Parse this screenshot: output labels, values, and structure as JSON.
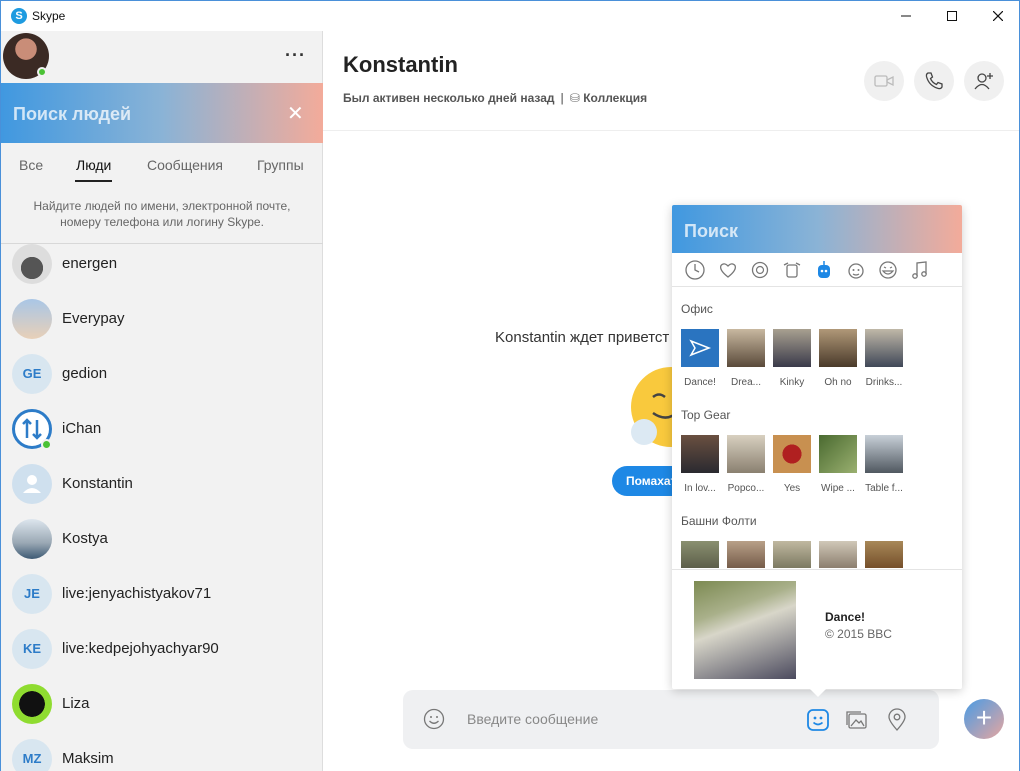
{
  "window": {
    "title": "Skype"
  },
  "sidebar": {
    "search_placeholder": "Поиск людей",
    "tabs": [
      {
        "label": "Все",
        "active": false
      },
      {
        "label": "Люди",
        "active": true
      },
      {
        "label": "Сообщения",
        "active": false
      },
      {
        "label": "Группы",
        "active": false
      }
    ],
    "hint": "Найдите людей по имени, электронной почте, номеру телефона или логину Skype.",
    "contacts": [
      {
        "name": "energen",
        "initials": "",
        "avatar": "photo",
        "online": false
      },
      {
        "name": "Everypay",
        "initials": "",
        "avatar": "photo",
        "online": false
      },
      {
        "name": "gedion",
        "initials": "GE",
        "avatar": "initials",
        "online": false
      },
      {
        "name": "iChan",
        "initials": "",
        "avatar": "photo",
        "online": true
      },
      {
        "name": "Konstantin",
        "initials": "",
        "avatar": "default-user",
        "online": false
      },
      {
        "name": "Kostya",
        "initials": "",
        "avatar": "photo",
        "online": false
      },
      {
        "name": "live:jenyachistyakov71",
        "initials": "JE",
        "avatar": "initials",
        "online": false
      },
      {
        "name": "live:kedpejohyachyar90",
        "initials": "KE",
        "avatar": "initials",
        "online": false
      },
      {
        "name": "Liza",
        "initials": "",
        "avatar": "photo",
        "online": false
      },
      {
        "name": "Maksim",
        "initials": "MZ",
        "avatar": "initials",
        "online": false
      }
    ]
  },
  "chat": {
    "title": "Konstantin",
    "last_seen": "Был активен несколько дней назад",
    "collection_label": "Коллекция",
    "awaiting_text": "Konstantin ждет приветст",
    "wave_button": "Помахат",
    "composer_placeholder": "Введите сообщение"
  },
  "sticker_popup": {
    "search_placeholder": "Поиск",
    "categories": [
      "clock-icon",
      "heart-icon",
      "face-icon",
      "pet-icon",
      "bot-icon",
      "monkey-icon",
      "laugh-icon",
      "music-icon"
    ],
    "active_category": "bot-icon",
    "sections": [
      {
        "title": "Офис",
        "stickers": [
          "Dance!",
          "Drea...",
          "Kinky",
          "Oh no",
          "Drinks..."
        ]
      },
      {
        "title": "Top Gear",
        "stickers": [
          "In lov...",
          "Popco...",
          "Yes",
          "Wipe ...",
          "Table f..."
        ]
      },
      {
        "title": "Башни Фолти",
        "stickers": [
          "",
          "",
          "",
          "",
          ""
        ]
      }
    ],
    "preview": {
      "name": "Dance!",
      "copyright": "© 2015 BBC"
    }
  },
  "colors": {
    "accent": "#1e88e5",
    "online": "#4bc236",
    "search_gradient_start": "#4098e0",
    "search_gradient_end": "#f3ab9a"
  }
}
